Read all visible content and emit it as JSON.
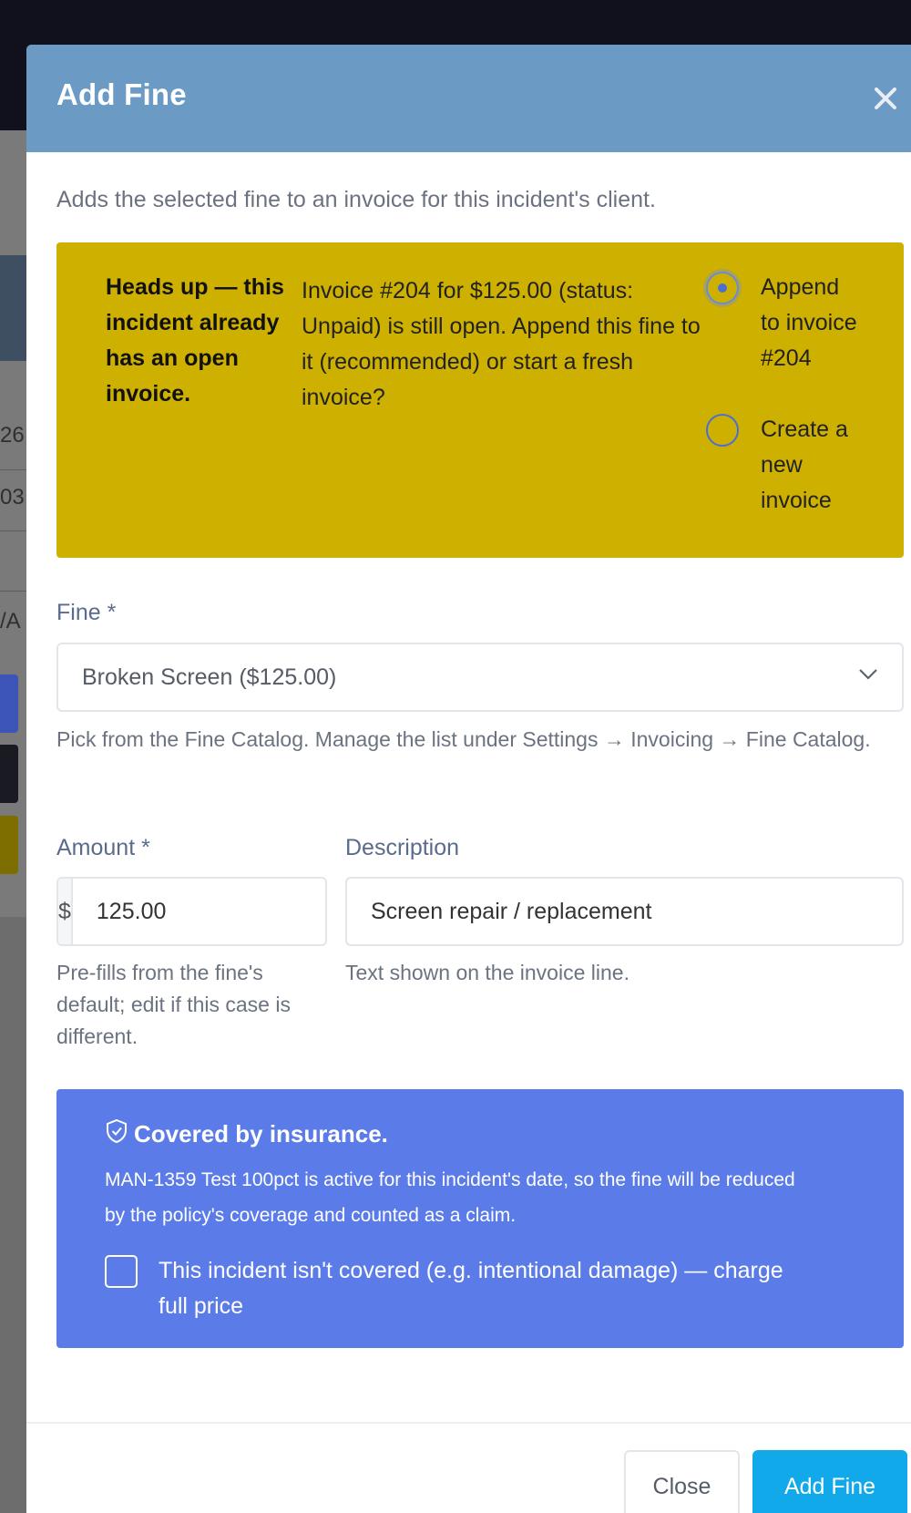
{
  "colors": {
    "header": "#6b9ac4",
    "warning": "#cdb000",
    "insurance": "#5b7ce8",
    "primary_button": "#12a9ea"
  },
  "background": {
    "rows": [
      "26",
      "03",
      "/A"
    ]
  },
  "modal": {
    "title": "Add Fine",
    "close_icon": "close-icon",
    "intro": "Adds the selected fine to an invoice for this incident's client."
  },
  "warning": {
    "title": "Heads up — this incident already has an open invoice.",
    "body": "Invoice #204 for $125.00 (status: Unpaid) is still open. Append this fine to it (recommended) or start a fresh invoice?",
    "options": [
      {
        "label": "Append to invoice #204",
        "checked": true
      },
      {
        "label": "Create a new invoice",
        "checked": false
      }
    ]
  },
  "fine": {
    "label": "Fine *",
    "selected": "Broken Screen ($125.00)",
    "help": "Pick from the Fine Catalog. Manage the list under Settings → Invoicing → Fine Catalog."
  },
  "amount": {
    "label": "Amount *",
    "prefix": "$",
    "value": "125.00",
    "help": "Pre-fills from the fine's default; edit if this case is different."
  },
  "description": {
    "label": "Description",
    "value": "Screen repair / replacement",
    "help": "Text shown on the invoice line."
  },
  "insurance": {
    "icon": "shield-check-icon",
    "title": "Covered by insurance.",
    "body": "MAN-1359 Test 100pct is active for this incident's date, so the fine will be reduced by the policy's coverage and counted as a claim.",
    "checkbox_label": "This incident isn't covered (e.g. intentional damage) — charge full price",
    "checked": false
  },
  "footer": {
    "close_label": "Close",
    "submit_label": "Add Fine"
  }
}
